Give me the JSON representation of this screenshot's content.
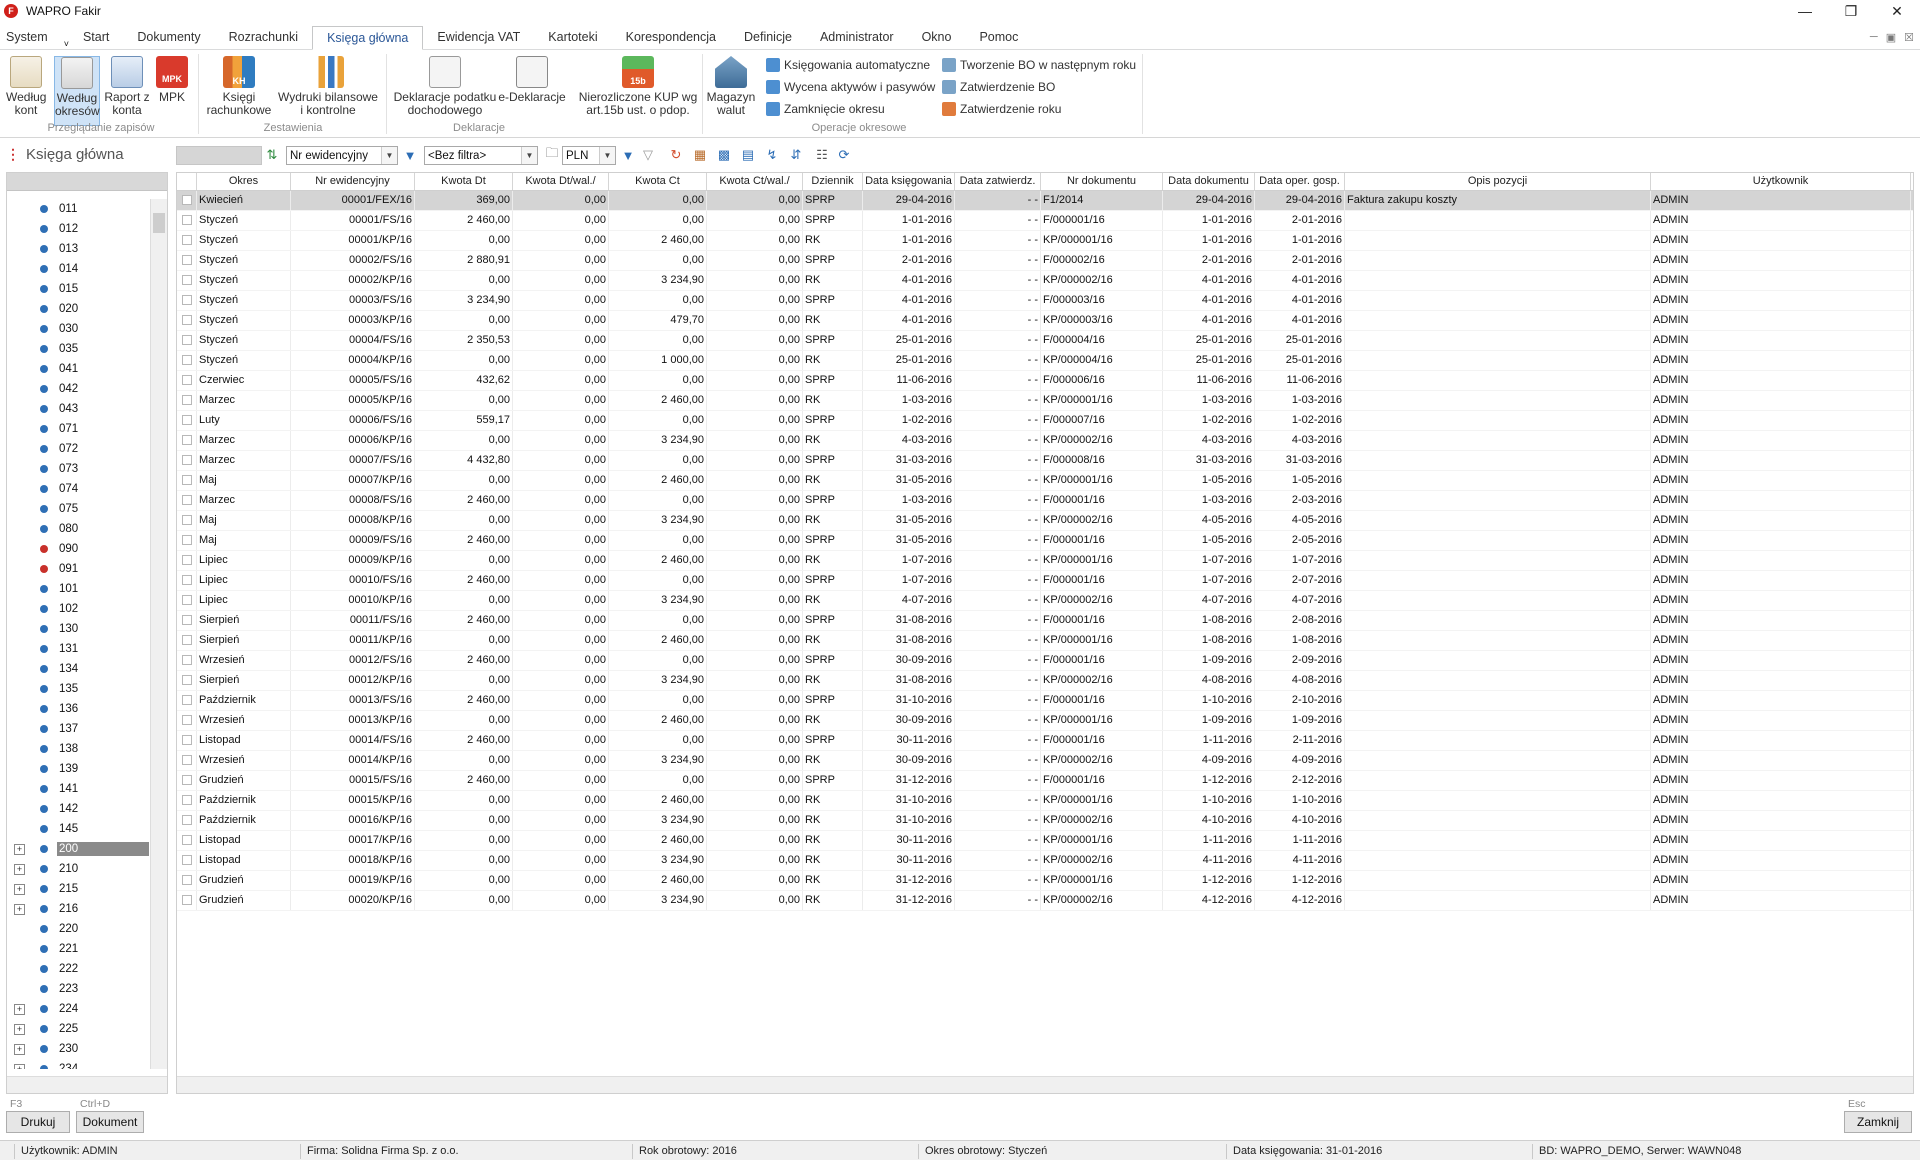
{
  "window": {
    "title": "WAPRO Fakir",
    "logo": "F"
  },
  "menu": [
    "System",
    "Start",
    "Dokumenty",
    "Rozrachunki",
    "Księga główna",
    "Ewidencja VAT",
    "Kartoteki",
    "Korespondencja",
    "Definicje",
    "Administrator",
    "Okno",
    "Pomoc"
  ],
  "menu_active": "Księga główna",
  "ribbon": {
    "przegladanie": {
      "label": "Przeglądanie zapisów",
      "b1": "Według",
      "b1b": "kont",
      "b2": "Według",
      "b2b": "okresów",
      "b3": "Raport z",
      "b3b": "konta",
      "b4": "MPK",
      "b4icon": "MPK"
    },
    "zestawienia": {
      "label": "Zestawienia",
      "b1": "Księgi",
      "b1b": "rachunkowe",
      "b2": "Wydruki bilansowe",
      "b2b": "i kontrolne",
      "b1icon": "KH"
    },
    "deklaracje": {
      "label": "Deklaracje",
      "b1": "Deklaracje podatku",
      "b1b": "dochodowego",
      "b2": "e-Deklaracje",
      "b3": "Nierozliczone KUP wg",
      "b3b": "art.15b ust. o pdop.",
      "b3icon": "15b"
    },
    "operacje": {
      "label": "Operacje okresowe",
      "b1": "Magazyn",
      "b1b": "walut",
      "s1": "Księgowania automatyczne",
      "s2": "Wycena aktywów i pasywów",
      "s3": "Zamknięcie okresu",
      "s4": "Tworzenie BO w następnym roku",
      "s5": "Zatwierdzenie BO",
      "s6": "Zatwierdzenie roku"
    }
  },
  "toolbar": {
    "title": "Księga główna",
    "sort": "Nr ewidencyjny",
    "filter": "<Bez filtra>",
    "currency": "PLN"
  },
  "tree": [
    {
      "code": "011",
      "exp": false,
      "color": "blue"
    },
    {
      "code": "012",
      "exp": false,
      "color": "blue"
    },
    {
      "code": "013",
      "exp": false,
      "color": "blue"
    },
    {
      "code": "014",
      "exp": false,
      "color": "blue"
    },
    {
      "code": "015",
      "exp": false,
      "color": "blue"
    },
    {
      "code": "020",
      "exp": false,
      "color": "blue"
    },
    {
      "code": "030",
      "exp": false,
      "color": "blue"
    },
    {
      "code": "035",
      "exp": false,
      "color": "blue"
    },
    {
      "code": "041",
      "exp": false,
      "color": "blue"
    },
    {
      "code": "042",
      "exp": false,
      "color": "blue"
    },
    {
      "code": "043",
      "exp": false,
      "color": "blue"
    },
    {
      "code": "071",
      "exp": false,
      "color": "blue"
    },
    {
      "code": "072",
      "exp": false,
      "color": "blue"
    },
    {
      "code": "073",
      "exp": false,
      "color": "blue"
    },
    {
      "code": "074",
      "exp": false,
      "color": "blue"
    },
    {
      "code": "075",
      "exp": false,
      "color": "blue"
    },
    {
      "code": "080",
      "exp": false,
      "color": "blue"
    },
    {
      "code": "090",
      "exp": false,
      "color": "red"
    },
    {
      "code": "091",
      "exp": false,
      "color": "red"
    },
    {
      "code": "101",
      "exp": false,
      "color": "blue"
    },
    {
      "code": "102",
      "exp": false,
      "color": "blue"
    },
    {
      "code": "130",
      "exp": false,
      "color": "blue"
    },
    {
      "code": "131",
      "exp": false,
      "color": "blue"
    },
    {
      "code": "134",
      "exp": false,
      "color": "blue"
    },
    {
      "code": "135",
      "exp": false,
      "color": "blue"
    },
    {
      "code": "136",
      "exp": false,
      "color": "blue"
    },
    {
      "code": "137",
      "exp": false,
      "color": "blue"
    },
    {
      "code": "138",
      "exp": false,
      "color": "blue"
    },
    {
      "code": "139",
      "exp": false,
      "color": "blue"
    },
    {
      "code": "141",
      "exp": false,
      "color": "blue"
    },
    {
      "code": "142",
      "exp": false,
      "color": "blue"
    },
    {
      "code": "145",
      "exp": false,
      "color": "blue"
    },
    {
      "code": "200",
      "exp": true,
      "color": "blue",
      "selected": true
    },
    {
      "code": "210",
      "exp": true,
      "color": "blue"
    },
    {
      "code": "215",
      "exp": true,
      "color": "blue"
    },
    {
      "code": "216",
      "exp": true,
      "color": "blue"
    },
    {
      "code": "220",
      "exp": false,
      "color": "blue"
    },
    {
      "code": "221",
      "exp": false,
      "color": "blue"
    },
    {
      "code": "222",
      "exp": false,
      "color": "blue"
    },
    {
      "code": "223",
      "exp": false,
      "color": "blue"
    },
    {
      "code": "224",
      "exp": true,
      "color": "blue"
    },
    {
      "code": "225",
      "exp": true,
      "color": "blue"
    },
    {
      "code": "230",
      "exp": true,
      "color": "blue"
    },
    {
      "code": "234",
      "exp": true,
      "color": "blue"
    }
  ],
  "columns": [
    "",
    "Okres",
    "Nr ewidencyjny",
    "Kwota Dt",
    "Kwota Dt/wal./",
    "Kwota Ct",
    "Kwota Ct/wal./",
    "Dziennik",
    "Data księgowania",
    "Data zatwierdz.",
    "Nr dokumentu",
    "Data dokumentu",
    "Data oper. gosp.",
    "Opis pozycji",
    "Użytkownik"
  ],
  "rows": [
    [
      "Kwiecień",
      "00001/FEX/16",
      "369,00",
      "0,00",
      "0,00",
      "0,00",
      "SPRP",
      "29-04-2016",
      "- -",
      "F1/2014",
      "29-04-2016",
      "29-04-2016",
      "Faktura zakupu koszty",
      "ADMIN"
    ],
    [
      "Styczeń",
      "00001/FS/16",
      "2 460,00",
      "0,00",
      "0,00",
      "0,00",
      "SPRP",
      "1-01-2016",
      "- -",
      "F/000001/16",
      "1-01-2016",
      "2-01-2016",
      "",
      "ADMIN"
    ],
    [
      "Styczeń",
      "00001/KP/16",
      "0,00",
      "0,00",
      "2 460,00",
      "0,00",
      "RK",
      "1-01-2016",
      "- -",
      "KP/000001/16",
      "1-01-2016",
      "1-01-2016",
      "",
      "ADMIN"
    ],
    [
      "Styczeń",
      "00002/FS/16",
      "2 880,91",
      "0,00",
      "0,00",
      "0,00",
      "SPRP",
      "2-01-2016",
      "- -",
      "F/000002/16",
      "2-01-2016",
      "2-01-2016",
      "",
      "ADMIN"
    ],
    [
      "Styczeń",
      "00002/KP/16",
      "0,00",
      "0,00",
      "3 234,90",
      "0,00",
      "RK",
      "4-01-2016",
      "- -",
      "KP/000002/16",
      "4-01-2016",
      "4-01-2016",
      "",
      "ADMIN"
    ],
    [
      "Styczeń",
      "00003/FS/16",
      "3 234,90",
      "0,00",
      "0,00",
      "0,00",
      "SPRP",
      "4-01-2016",
      "- -",
      "F/000003/16",
      "4-01-2016",
      "4-01-2016",
      "",
      "ADMIN"
    ],
    [
      "Styczeń",
      "00003/KP/16",
      "0,00",
      "0,00",
      "479,70",
      "0,00",
      "RK",
      "4-01-2016",
      "- -",
      "KP/000003/16",
      "4-01-2016",
      "4-01-2016",
      "",
      "ADMIN"
    ],
    [
      "Styczeń",
      "00004/FS/16",
      "2 350,53",
      "0,00",
      "0,00",
      "0,00",
      "SPRP",
      "25-01-2016",
      "- -",
      "F/000004/16",
      "25-01-2016",
      "25-01-2016",
      "",
      "ADMIN"
    ],
    [
      "Styczeń",
      "00004/KP/16",
      "0,00",
      "0,00",
      "1 000,00",
      "0,00",
      "RK",
      "25-01-2016",
      "- -",
      "KP/000004/16",
      "25-01-2016",
      "25-01-2016",
      "",
      "ADMIN"
    ],
    [
      "Czerwiec",
      "00005/FS/16",
      "432,62",
      "0,00",
      "0,00",
      "0,00",
      "SPRP",
      "11-06-2016",
      "- -",
      "F/000006/16",
      "11-06-2016",
      "11-06-2016",
      "",
      "ADMIN"
    ],
    [
      "Marzec",
      "00005/KP/16",
      "0,00",
      "0,00",
      "2 460,00",
      "0,00",
      "RK",
      "1-03-2016",
      "- -",
      "KP/000001/16",
      "1-03-2016",
      "1-03-2016",
      "",
      "ADMIN"
    ],
    [
      "Luty",
      "00006/FS/16",
      "559,17",
      "0,00",
      "0,00",
      "0,00",
      "SPRP",
      "1-02-2016",
      "- -",
      "F/000007/16",
      "1-02-2016",
      "1-02-2016",
      "",
      "ADMIN"
    ],
    [
      "Marzec",
      "00006/KP/16",
      "0,00",
      "0,00",
      "3 234,90",
      "0,00",
      "RK",
      "4-03-2016",
      "- -",
      "KP/000002/16",
      "4-03-2016",
      "4-03-2016",
      "",
      "ADMIN"
    ],
    [
      "Marzec",
      "00007/FS/16",
      "4 432,80",
      "0,00",
      "0,00",
      "0,00",
      "SPRP",
      "31-03-2016",
      "- -",
      "F/000008/16",
      "31-03-2016",
      "31-03-2016",
      "",
      "ADMIN"
    ],
    [
      "Maj",
      "00007/KP/16",
      "0,00",
      "0,00",
      "2 460,00",
      "0,00",
      "RK",
      "31-05-2016",
      "- -",
      "KP/000001/16",
      "1-05-2016",
      "1-05-2016",
      "",
      "ADMIN"
    ],
    [
      "Marzec",
      "00008/FS/16",
      "2 460,00",
      "0,00",
      "0,00",
      "0,00",
      "SPRP",
      "1-03-2016",
      "- -",
      "F/000001/16",
      "1-03-2016",
      "2-03-2016",
      "",
      "ADMIN"
    ],
    [
      "Maj",
      "00008/KP/16",
      "0,00",
      "0,00",
      "3 234,90",
      "0,00",
      "RK",
      "31-05-2016",
      "- -",
      "KP/000002/16",
      "4-05-2016",
      "4-05-2016",
      "",
      "ADMIN"
    ],
    [
      "Maj",
      "00009/FS/16",
      "2 460,00",
      "0,00",
      "0,00",
      "0,00",
      "SPRP",
      "31-05-2016",
      "- -",
      "F/000001/16",
      "1-05-2016",
      "2-05-2016",
      "",
      "ADMIN"
    ],
    [
      "Lipiec",
      "00009/KP/16",
      "0,00",
      "0,00",
      "2 460,00",
      "0,00",
      "RK",
      "1-07-2016",
      "- -",
      "KP/000001/16",
      "1-07-2016",
      "1-07-2016",
      "",
      "ADMIN"
    ],
    [
      "Lipiec",
      "00010/FS/16",
      "2 460,00",
      "0,00",
      "0,00",
      "0,00",
      "SPRP",
      "1-07-2016",
      "- -",
      "F/000001/16",
      "1-07-2016",
      "2-07-2016",
      "",
      "ADMIN"
    ],
    [
      "Lipiec",
      "00010/KP/16",
      "0,00",
      "0,00",
      "3 234,90",
      "0,00",
      "RK",
      "4-07-2016",
      "- -",
      "KP/000002/16",
      "4-07-2016",
      "4-07-2016",
      "",
      "ADMIN"
    ],
    [
      "Sierpień",
      "00011/FS/16",
      "2 460,00",
      "0,00",
      "0,00",
      "0,00",
      "SPRP",
      "31-08-2016",
      "- -",
      "F/000001/16",
      "1-08-2016",
      "2-08-2016",
      "",
      "ADMIN"
    ],
    [
      "Sierpień",
      "00011/KP/16",
      "0,00",
      "0,00",
      "2 460,00",
      "0,00",
      "RK",
      "31-08-2016",
      "- -",
      "KP/000001/16",
      "1-08-2016",
      "1-08-2016",
      "",
      "ADMIN"
    ],
    [
      "Wrzesień",
      "00012/FS/16",
      "2 460,00",
      "0,00",
      "0,00",
      "0,00",
      "SPRP",
      "30-09-2016",
      "- -",
      "F/000001/16",
      "1-09-2016",
      "2-09-2016",
      "",
      "ADMIN"
    ],
    [
      "Sierpień",
      "00012/KP/16",
      "0,00",
      "0,00",
      "3 234,90",
      "0,00",
      "RK",
      "31-08-2016",
      "- -",
      "KP/000002/16",
      "4-08-2016",
      "4-08-2016",
      "",
      "ADMIN"
    ],
    [
      "Październik",
      "00013/FS/16",
      "2 460,00",
      "0,00",
      "0,00",
      "0,00",
      "SPRP",
      "31-10-2016",
      "- -",
      "F/000001/16",
      "1-10-2016",
      "2-10-2016",
      "",
      "ADMIN"
    ],
    [
      "Wrzesień",
      "00013/KP/16",
      "0,00",
      "0,00",
      "2 460,00",
      "0,00",
      "RK",
      "30-09-2016",
      "- -",
      "KP/000001/16",
      "1-09-2016",
      "1-09-2016",
      "",
      "ADMIN"
    ],
    [
      "Listopad",
      "00014/FS/16",
      "2 460,00",
      "0,00",
      "0,00",
      "0,00",
      "SPRP",
      "30-11-2016",
      "- -",
      "F/000001/16",
      "1-11-2016",
      "2-11-2016",
      "",
      "ADMIN"
    ],
    [
      "Wrzesień",
      "00014/KP/16",
      "0,00",
      "0,00",
      "3 234,90",
      "0,00",
      "RK",
      "30-09-2016",
      "- -",
      "KP/000002/16",
      "4-09-2016",
      "4-09-2016",
      "",
      "ADMIN"
    ],
    [
      "Grudzień",
      "00015/FS/16",
      "2 460,00",
      "0,00",
      "0,00",
      "0,00",
      "SPRP",
      "31-12-2016",
      "- -",
      "F/000001/16",
      "1-12-2016",
      "2-12-2016",
      "",
      "ADMIN"
    ],
    [
      "Październik",
      "00015/KP/16",
      "0,00",
      "0,00",
      "2 460,00",
      "0,00",
      "RK",
      "31-10-2016",
      "- -",
      "KP/000001/16",
      "1-10-2016",
      "1-10-2016",
      "",
      "ADMIN"
    ],
    [
      "Październik",
      "00016/KP/16",
      "0,00",
      "0,00",
      "3 234,90",
      "0,00",
      "RK",
      "31-10-2016",
      "- -",
      "KP/000002/16",
      "4-10-2016",
      "4-10-2016",
      "",
      "ADMIN"
    ],
    [
      "Listopad",
      "00017/KP/16",
      "0,00",
      "0,00",
      "2 460,00",
      "0,00",
      "RK",
      "30-11-2016",
      "- -",
      "KP/000001/16",
      "1-11-2016",
      "1-11-2016",
      "",
      "ADMIN"
    ],
    [
      "Listopad",
      "00018/KP/16",
      "0,00",
      "0,00",
      "3 234,90",
      "0,00",
      "RK",
      "30-11-2016",
      "- -",
      "KP/000002/16",
      "4-11-2016",
      "4-11-2016",
      "",
      "ADMIN"
    ],
    [
      "Grudzień",
      "00019/KP/16",
      "0,00",
      "0,00",
      "2 460,00",
      "0,00",
      "RK",
      "31-12-2016",
      "- -",
      "KP/000001/16",
      "1-12-2016",
      "1-12-2016",
      "",
      "ADMIN"
    ],
    [
      "Grudzień",
      "00020/KP/16",
      "0,00",
      "0,00",
      "3 234,90",
      "0,00",
      "RK",
      "31-12-2016",
      "- -",
      "KP/000002/16",
      "4-12-2016",
      "4-12-2016",
      "",
      "ADMIN"
    ]
  ],
  "bottom": {
    "key_print": "F3",
    "key_doc": "Ctrl+D",
    "key_close": "Esc",
    "print": "Drukuj",
    "document": "Dokument",
    "close": "Zamknij"
  },
  "status": {
    "user": "Użytkownik: ADMIN",
    "firm": "Firma: Solidna Firma Sp. z o.o.",
    "year": "Rok obrotowy: 2016",
    "period": "Okres obrotowy: Styczeń",
    "date": "Data księgowania: 31-01-2016",
    "db": "BD: WAPRO_DEMO, Serwer: WAWN048"
  },
  "colors": {
    "accent": "#2b5797",
    "selected_row": "#d4d4d4",
    "tree_dot": "#2f6fb5",
    "tree_dot_red": "#c8312b"
  }
}
